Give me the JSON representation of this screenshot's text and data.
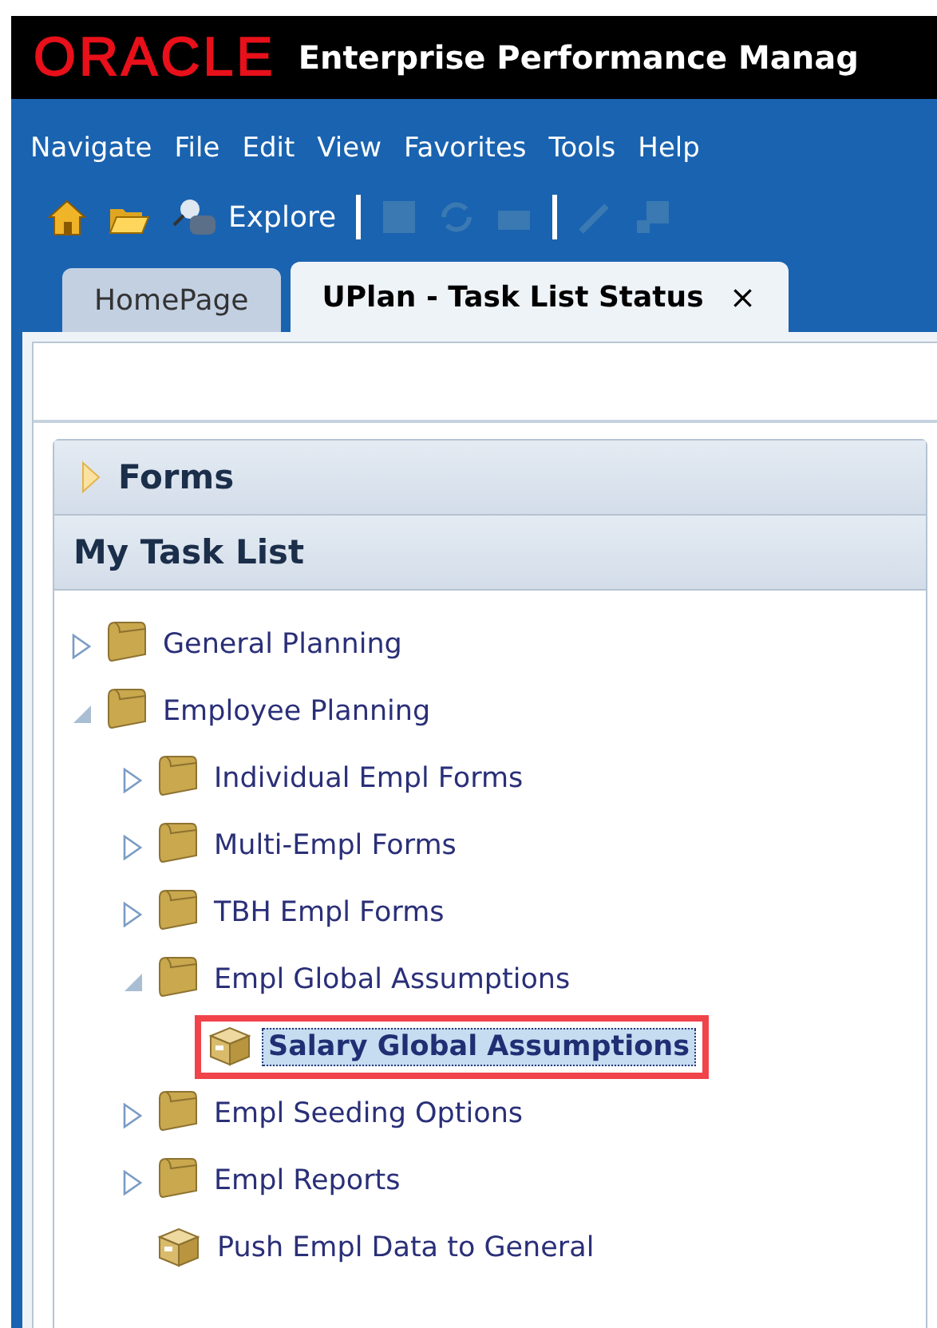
{
  "header": {
    "logo": "ORACLE",
    "title": "Enterprise Performance Manag"
  },
  "menu": [
    "Navigate",
    "File",
    "Edit",
    "View",
    "Favorites",
    "Tools",
    "Help"
  ],
  "toolbar": [
    {
      "kind": "home",
      "disabled": false
    },
    {
      "kind": "open",
      "disabled": false
    },
    {
      "kind": "explore",
      "label": "Explore",
      "disabled": false
    },
    {
      "kind": "separator"
    },
    {
      "kind": "save",
      "disabled": true
    },
    {
      "kind": "refresh",
      "disabled": true
    },
    {
      "kind": "print",
      "disabled": true
    },
    {
      "kind": "separator"
    },
    {
      "kind": "pencil",
      "disabled": true
    },
    {
      "kind": "grid",
      "disabled": true
    }
  ],
  "tabs": [
    {
      "label": "HomePage",
      "selected": false
    },
    {
      "label": "UPlan - Task List Status",
      "selected": true,
      "close": "×"
    }
  ],
  "panels": [
    {
      "title": "Forms",
      "kind": "collapsed"
    },
    {
      "title": "My Task List",
      "kind": "open"
    }
  ],
  "tree": [
    {
      "label": "General Planning",
      "kind": "folder",
      "expanded": false,
      "selected": false
    },
    {
      "label": "Employee Planning",
      "kind": "folder",
      "expanded": true,
      "selected": false,
      "children": [
        {
          "label": "Individual Empl Forms",
          "kind": "folder",
          "expanded": false,
          "selected": false
        },
        {
          "label": "Multi-Empl Forms",
          "kind": "folder",
          "expanded": false,
          "selected": false
        },
        {
          "label": "TBH Empl Forms",
          "kind": "folder",
          "expanded": false,
          "selected": false
        },
        {
          "label": "Empl Global Assumptions",
          "kind": "folder",
          "expanded": true,
          "selected": false,
          "children": [
            {
              "label": "Salary Global Assumptions",
              "kind": "task",
              "selected": true,
              "annotated": true
            }
          ]
        },
        {
          "label": "Empl Seeding Options",
          "kind": "folder",
          "expanded": false,
          "selected": false
        },
        {
          "label": "Empl Reports",
          "kind": "folder",
          "expanded": false,
          "selected": false
        },
        {
          "label": "Push Empl Data to General",
          "kind": "task",
          "selected": false,
          "annotated": false
        }
      ]
    }
  ]
}
